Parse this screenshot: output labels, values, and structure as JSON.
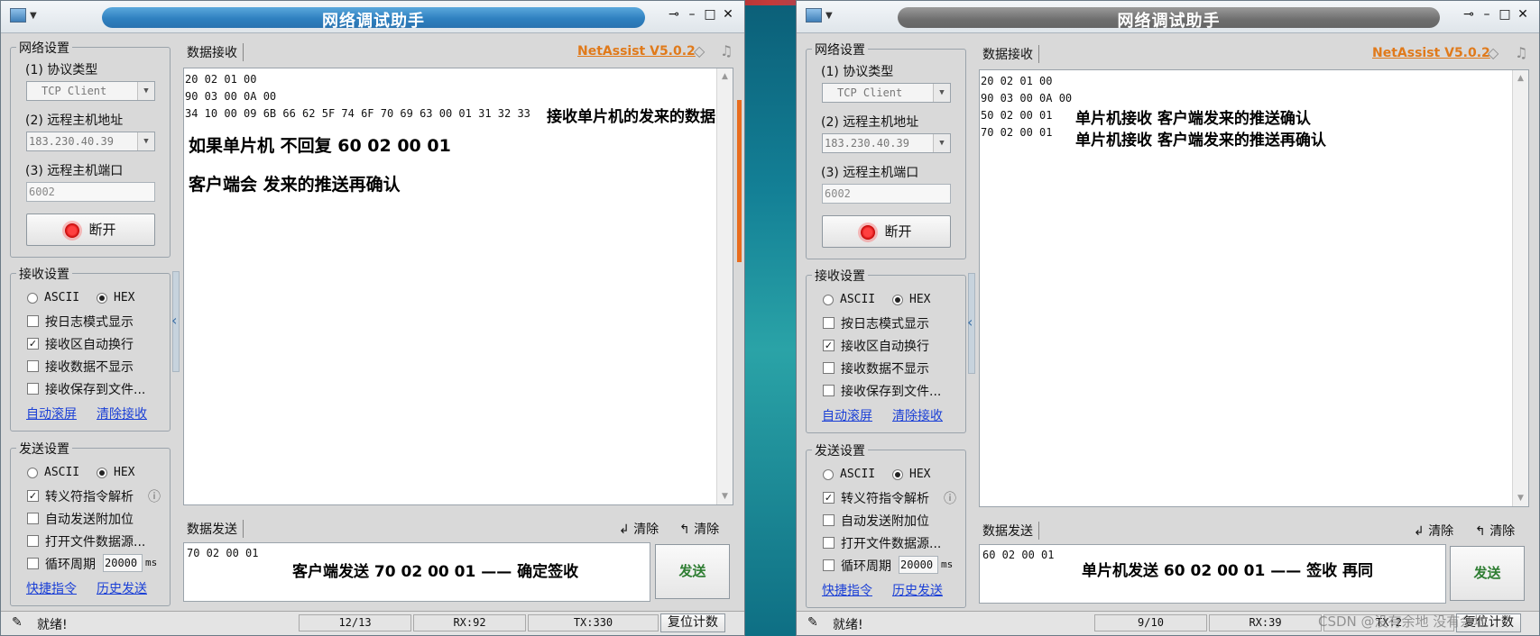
{
  "left": {
    "title": "网络调试助手",
    "brand": "NetAssist V5.0.2",
    "net_settings": {
      "group": "网络设置",
      "protocol_label": "(1) 协议类型",
      "protocol_value": "TCP Client",
      "host_label": "(2) 远程主机地址",
      "host_value": "183.230.40.39",
      "port_label": "(3) 远程主机端口",
      "port_value": "6002",
      "disconnect": "断开"
    },
    "recv_settings": {
      "group": "接收设置",
      "ascii": "ASCII",
      "hex": "HEX",
      "opt1": "按日志模式显示",
      "opt2": "接收区自动换行",
      "opt3": "接收数据不显示",
      "opt4": "接收保存到文件...",
      "link1": "自动滚屏",
      "link2": "清除接收"
    },
    "send_settings": {
      "group": "发送设置",
      "ascii": "ASCII",
      "hex": "HEX",
      "opt1": "转义符指令解析",
      "opt2": "自动发送附加位",
      "opt3": "打开文件数据源...",
      "opt4": "循环周期",
      "period": "20000",
      "unit": "ms",
      "link1": "快捷指令",
      "link2": "历史发送"
    },
    "recv_tab": "数据接收",
    "send_tab": "数据发送",
    "clear1": "清除",
    "clear2": "清除",
    "recv_lines": [
      "20 02 01 00",
      "90 03 00 0A 00",
      "34 10 00 09 6B 66 62 5F 74 6F 70 69 63 00 01 31 32 33"
    ],
    "annot_line3": "接收单片机的发来的数据",
    "annot_big1": "如果单片机 不回复 60 02 00 01",
    "annot_big2": "客户端会 发来的推送再确认",
    "send_value": "70 02 00 01",
    "send_annot": "客户端发送 70 02 00 01 —— 确定签收",
    "send_button": "发送",
    "status": "就绪!",
    "count": "12/13",
    "rx": "RX:92",
    "tx": "TX:330",
    "reset": "复位计数"
  },
  "right": {
    "title": "网络调试助手",
    "brand": "NetAssist V5.0.2",
    "net_settings": {
      "group": "网络设置",
      "protocol_label": "(1) 协议类型",
      "protocol_value": "TCP Client",
      "host_label": "(2) 远程主机地址",
      "host_value": "183.230.40.39",
      "port_label": "(3) 远程主机端口",
      "port_value": "6002",
      "disconnect": "断开"
    },
    "recv_settings": {
      "group": "接收设置",
      "ascii": "ASCII",
      "hex": "HEX",
      "opt1": "按日志模式显示",
      "opt2": "接收区自动换行",
      "opt3": "接收数据不显示",
      "opt4": "接收保存到文件...",
      "link1": "自动滚屏",
      "link2": "清除接收"
    },
    "send_settings": {
      "group": "发送设置",
      "ascii": "ASCII",
      "hex": "HEX",
      "opt1": "转义符指令解析",
      "opt2": "自动发送附加位",
      "opt3": "打开文件数据源...",
      "opt4": "循环周期",
      "period": "20000",
      "unit": "ms",
      "link1": "快捷指令",
      "link2": "历史发送"
    },
    "recv_tab": "数据接收",
    "send_tab": "数据发送",
    "clear1": "清除",
    "clear2": "清除",
    "recv_lines": [
      "20 02 01 00",
      "90 03 00 0A 00",
      "50 02 00 01",
      "70 02 00 01"
    ],
    "annot_line3": "单片机接收 客户端发来的推送确认",
    "annot_line4": "单片机接收 客户端发来的推送再确认",
    "send_value": "60 02 00 01",
    "send_annot": "单片机发送 60 02 00 01 —— 签收 再同",
    "send_button": "发送",
    "status": "就绪!",
    "count": "9/10",
    "rx": "RX:39",
    "tx": "TX:2",
    "reset": "复位计数"
  },
  "watermark": "CSDN @没有余地 没有余地"
}
